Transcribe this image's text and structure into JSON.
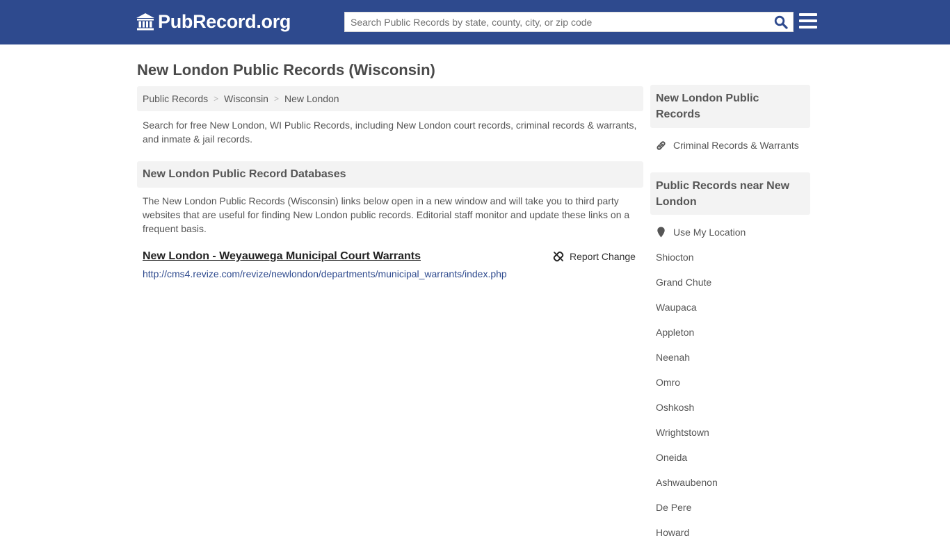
{
  "header": {
    "logo_text": "PubRecord.org",
    "search_placeholder": "Search Public Records by state, county, city, or zip code",
    "search_value": "",
    "colors": {
      "brand": "#2e4a8e",
      "search_icon": "#2e4a8e"
    }
  },
  "page": {
    "title": "New London Public Records (Wisconsin)"
  },
  "breadcrumb": [
    {
      "label": "Public Records"
    },
    {
      "label": "Wisconsin"
    },
    {
      "label": "New London"
    }
  ],
  "breadcrumb_separator": ">",
  "intro": "Search for free New London, WI Public Records, including New London court records, criminal records & warrants, and inmate & jail records.",
  "databases": {
    "heading": "New London Public Record Databases",
    "description": "The New London Public Records (Wisconsin) links below open in a new window and will take you to third party websites that are useful for finding New London public records. Editorial staff monitor and update these links on a frequent basis.",
    "records": [
      {
        "title": "New London - Weyauwega Municipal Court Warrants",
        "url": "http://cms4.revize.com/revize/newlondon/departments/municipal_warrants/index.php",
        "report_label": "Report Change"
      }
    ]
  },
  "sidebar": {
    "box1": {
      "heading": "New London Public Records",
      "links": [
        {
          "label": "Criminal Records & Warrants",
          "icon": "link-icon"
        }
      ]
    },
    "box2": {
      "heading": "Public Records near New London",
      "location_label": "Use My Location",
      "cities": [
        "Shiocton",
        "Grand Chute",
        "Waupaca",
        "Appleton",
        "Neenah",
        "Omro",
        "Oshkosh",
        "Wrightstown",
        "Oneida",
        "Ashwaubenon",
        "De Pere",
        "Howard"
      ]
    }
  }
}
